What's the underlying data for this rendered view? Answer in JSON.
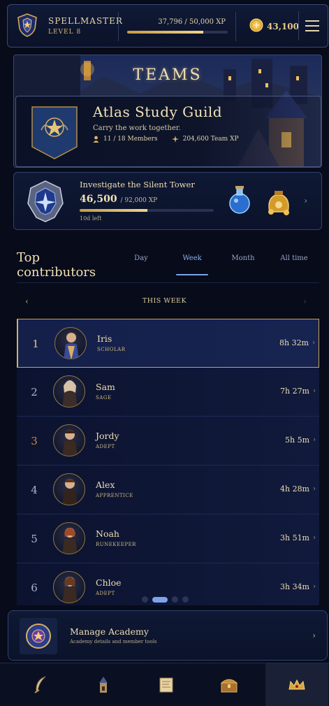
{
  "player": {
    "name": "SPELLMASTER",
    "level": "LEVEL 8",
    "xp_text": "37,796 / 50,000 XP",
    "xp_progress": 0.756,
    "coins": "43,100"
  },
  "banner": {
    "title": "TEAMS",
    "guild_name": "Atlas Study Guild",
    "tagline": "Carry the work together.",
    "members": "11 / 18 Members",
    "team_xp": "204,600 Team XP"
  },
  "quest": {
    "title": "Investigate the Silent Tower",
    "xp_current": "46,500",
    "xp_total": "/ 92,000 XP",
    "progress": 0.505,
    "time_left": "10d left"
  },
  "contributors": {
    "title": "Top contributors",
    "tabs": [
      "Day",
      "Week",
      "Month",
      "All time"
    ],
    "active_tab": "Week",
    "period_label": "THIS WEEK",
    "rows": [
      {
        "rank": "1",
        "name": "Iris",
        "title": "SCHOLAR",
        "time": "8h 32m"
      },
      {
        "rank": "2",
        "name": "Sam",
        "title": "SAGE",
        "time": "7h 27m"
      },
      {
        "rank": "3",
        "name": "Jordy",
        "title": "ADEPT",
        "time": "5h 5m"
      },
      {
        "rank": "4",
        "name": "Alex",
        "title": "APPRENTICE",
        "time": "4h 28m"
      },
      {
        "rank": "5",
        "name": "Noah",
        "title": "RUNEKEEPER",
        "time": "3h 51m"
      },
      {
        "rank": "6",
        "name": "Chloe",
        "title": "ADEPT",
        "time": "3h 34m"
      }
    ]
  },
  "manage": {
    "title": "Manage Academy",
    "subtitle": "Academy details and member tools"
  },
  "nav": {
    "items": [
      "quill-icon",
      "wizard-tower-icon",
      "scroll-map-icon",
      "treasure-chest-icon",
      "crown-icon"
    ],
    "active_index": 4
  },
  "colors": {
    "accent_gold": "#d9b66a",
    "accent_blue": "#7ea3ea",
    "background": "#070b1a"
  }
}
